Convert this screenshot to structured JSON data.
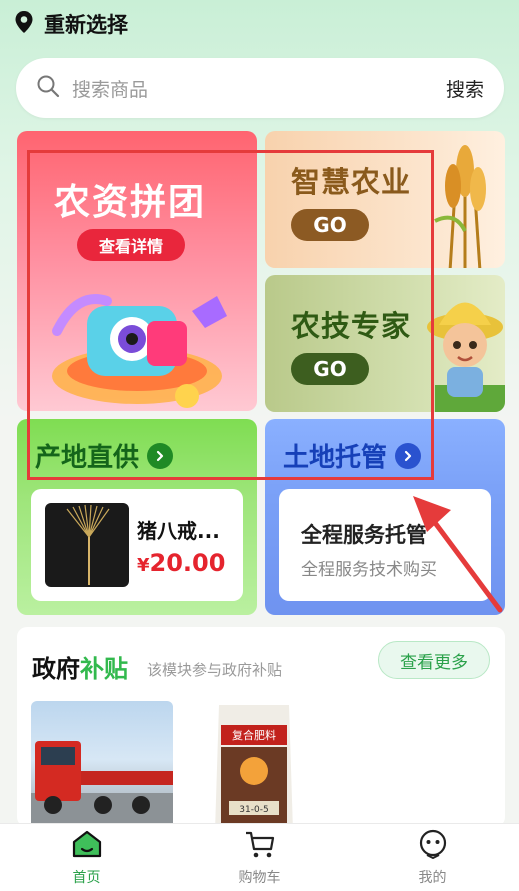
{
  "location": {
    "label": "重新选择",
    "icon": "location-pin-icon"
  },
  "search": {
    "placeholder": "搜索商品",
    "button": "搜索",
    "icon": "search-icon"
  },
  "banners": {
    "group_buy": {
      "title": "农资拼团",
      "button": "查看详情"
    },
    "smart_agri": {
      "title": "智慧农业",
      "button": "GO"
    },
    "agri_expert": {
      "title": "农技专家",
      "button": "GO"
    }
  },
  "origin_supply": {
    "title": "产地直供",
    "product": {
      "name": "猪八戒...",
      "currency": "¥",
      "price": "20.00"
    }
  },
  "land_trust": {
    "title": "土地托管",
    "service": {
      "title": "全程服务托管",
      "subtitle": "全程服务技术购买"
    }
  },
  "subsidy": {
    "title_main": "政府",
    "title_accent": "补贴",
    "desc": "该模块参与政府补贴",
    "more": "查看更多",
    "bag_label": "复合肥料",
    "bag_code": "31-0-5"
  },
  "tabs": [
    {
      "label": "首页",
      "icon": "home-icon",
      "active": true
    },
    {
      "label": "购物车",
      "icon": "cart-icon",
      "active": false
    },
    {
      "label": "我的",
      "icon": "profile-icon",
      "active": false
    }
  ],
  "colors": {
    "accent_green": "#2aa14a",
    "highlight_red": "#e53b3b",
    "price_red": "#e5242e"
  }
}
